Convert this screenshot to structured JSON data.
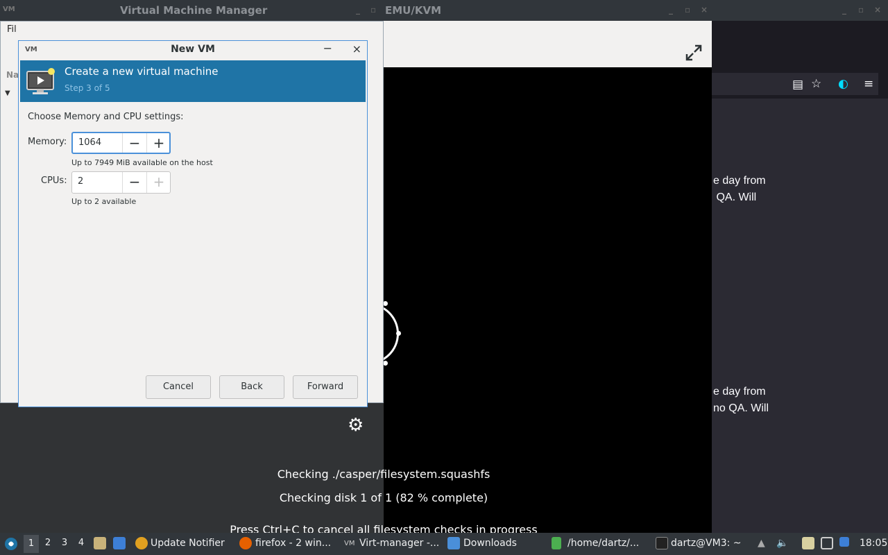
{
  "desktop": {
    "main_title": "Virtual Machine Manager",
    "console_title": "EMU/KVM"
  },
  "main_window": {
    "menu_partial": "Fil",
    "list_header_partial": "Na"
  },
  "dialog": {
    "title": "New VM",
    "minimize_glyph": "−",
    "close_glyph": "×",
    "banner_title": "Create a new virtual machine",
    "banner_step": "Step 3 of 5",
    "section_label": "Choose Memory and CPU settings:",
    "memory": {
      "label": "Memory:",
      "value": "1064",
      "hint": "Up to 7949 MiB available on the host"
    },
    "cpus": {
      "label": "CPUs:",
      "value": "2",
      "hint": "Up to 2 available"
    },
    "buttons": {
      "cancel": "Cancel",
      "back": "Back",
      "forward": "Forward"
    }
  },
  "console": {
    "line1": "Checking ./casper/filesystem.squashfs",
    "line2": "Checking disk 1 of 1 (82 % complete)",
    "line3": "Press Ctrl+C to cancel all filesystem checks in progress"
  },
  "browser": {
    "para1_line1": "e day from",
    "para1_line2": " QA. Will",
    "para2_line1": "e day from",
    "para2_line2": "no QA. Will"
  },
  "taskbar": {
    "workspaces": [
      "1",
      "2",
      "3",
      "4"
    ],
    "active_workspace": "1",
    "items": {
      "update": "Update Notifier",
      "firefox": "firefox - 2 win...",
      "virt": "Virt-manager -...",
      "downloads": "Downloads",
      "home": "/home/dartz/...",
      "terminal": "dartz@VM3: ~"
    },
    "clock": "18:05"
  }
}
